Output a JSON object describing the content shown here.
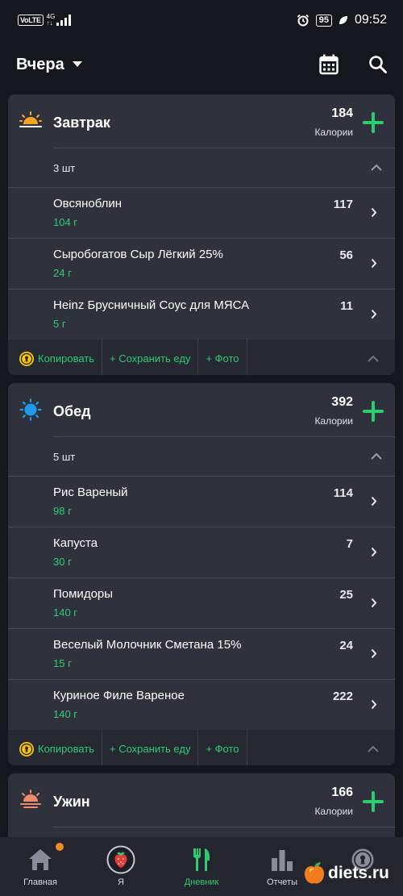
{
  "status_bar": {
    "volte": "VoLTE",
    "network": "4G",
    "battery": "95",
    "time": "09:52"
  },
  "header": {
    "day": "Вчера",
    "icons": [
      "calendar-icon",
      "search-icon"
    ]
  },
  "meals": [
    {
      "title": "Завтрак",
      "icon": "sunrise-icon",
      "calories": "184",
      "calories_label": "Калории",
      "count": "3 шт",
      "items": [
        {
          "name": "Овсяноблин",
          "weight": "104 г",
          "calories": "117"
        },
        {
          "name": "Сыробогатов Сыр Лёгкий 25%",
          "weight": "24 г",
          "calories": "56"
        },
        {
          "name": "Heinz Брусничный Соус для МЯСА",
          "weight": "5 г",
          "calories": "11"
        }
      ],
      "actions": {
        "copy": "Копировать",
        "save": "+ Сохранить еду",
        "photo": "+ Фото"
      }
    },
    {
      "title": "Обед",
      "icon": "sun-icon",
      "calories": "392",
      "calories_label": "Калории",
      "count": "5 шт",
      "items": [
        {
          "name": "Рис Вареный",
          "weight": "98 г",
          "calories": "114"
        },
        {
          "name": "Капуста",
          "weight": "30 г",
          "calories": "7"
        },
        {
          "name": "Помидоры",
          "weight": "140 г",
          "calories": "25"
        },
        {
          "name": "Веселый Молочник Сметана 15%",
          "weight": "15 г",
          "calories": "24"
        },
        {
          "name": "Куриное Филе Вареное",
          "weight": "140 г",
          "calories": "222"
        }
      ],
      "actions": {
        "copy": "Копировать",
        "save": "+ Сохранить еду",
        "photo": "+ Фото"
      }
    },
    {
      "title": "Ужин",
      "icon": "sunset-icon",
      "calories": "166",
      "calories_label": "Калории"
    }
  ],
  "nav": [
    {
      "label": "Главная",
      "icon": "home-icon"
    },
    {
      "label": "Я",
      "icon": "strawberry-avatar-icon"
    },
    {
      "label": "Дневник",
      "icon": "fork-knife-icon",
      "active": true
    },
    {
      "label": "Отчеты",
      "icon": "bar-chart-icon"
    },
    {
      "label": "",
      "icon": "keyhole-icon"
    }
  ],
  "watermark": "diets.ru",
  "colors": {
    "background": "#15171e",
    "card": "#2f323d",
    "accent_green": "#2ecc71",
    "notification": "#f08a24"
  }
}
